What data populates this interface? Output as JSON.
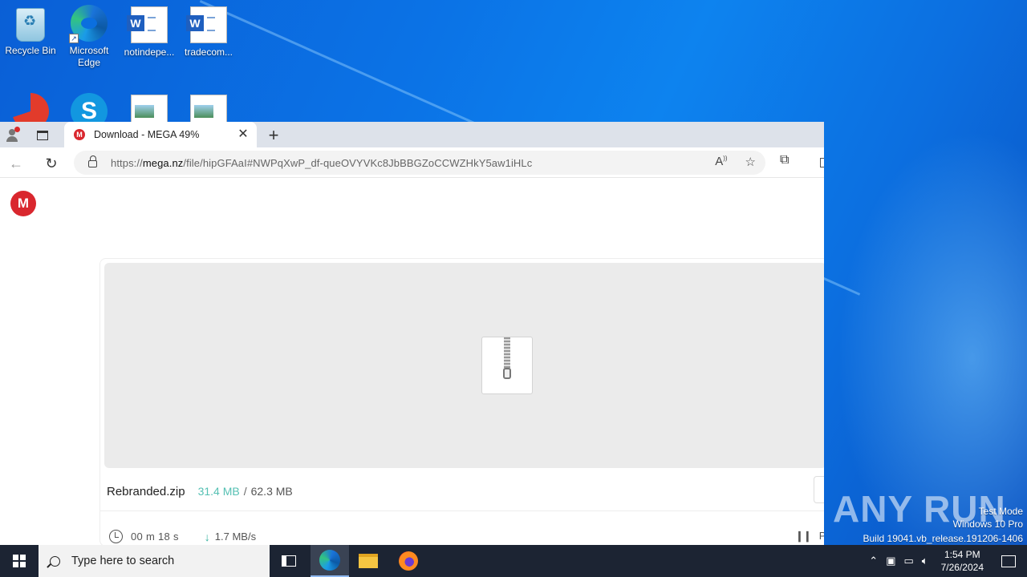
{
  "desktop": {
    "icons": [
      {
        "label": "Recycle Bin"
      },
      {
        "label": "Microsoft Edge"
      },
      {
        "label": "notindepe..."
      },
      {
        "label": "tradecom..."
      }
    ],
    "partial_icons": [
      "ccleaner-icon",
      "skype-icon",
      "image-file-icon",
      "image-file-icon"
    ]
  },
  "browser": {
    "tab": {
      "title": "Download - MEGA 49%",
      "favicon": "M"
    },
    "address": {
      "prefix": "https://",
      "domain": "mega.nz",
      "path": "/file/hipGFAaI#NWPqXwP_df-queOVYVKc8JbBBGZoCCWZHkY5aw1iHLc"
    }
  },
  "page": {
    "logo": "M",
    "file_name": "Rebranded.zip",
    "downloaded": "31.4 MB",
    "separator": "/",
    "total_size": "62.3 MB",
    "progress": 0.49,
    "eta": "00 m  18 s",
    "speed": "1.7 MB/s",
    "pause_label": "Pa"
  },
  "watermark": {
    "logo_text": "ANY RUN",
    "mode": "Test Mode",
    "os": "Windows 10 Pro",
    "build": "Build 19041.vb_release.191206-1406"
  },
  "taskbar": {
    "search_placeholder": "Type here to search",
    "time": "1:54 PM",
    "date": "7/26/2024"
  },
  "colors": {
    "mega_red": "#d9272e",
    "downloaded_teal": "#55c0b3",
    "taskbar_bg": "#1c2433"
  }
}
